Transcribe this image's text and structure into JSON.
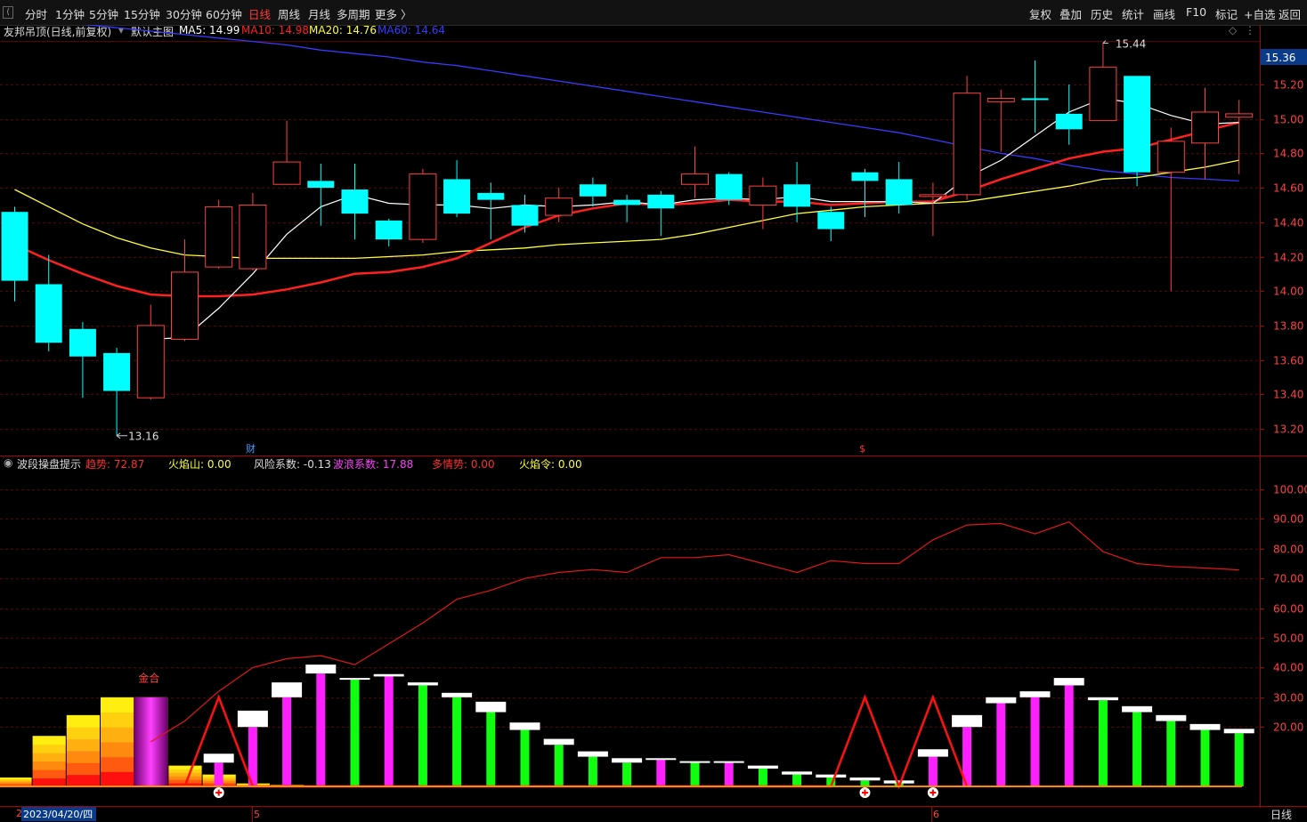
{
  "toolbar": {
    "periods": [
      "分时",
      "1分钟",
      "5分钟",
      "15分钟",
      "30分钟",
      "60分钟",
      "日线",
      "周线",
      "月线",
      "多周期",
      "更多 〉"
    ],
    "active": "日线",
    "right_buttons": [
      "复权",
      "叠加",
      "历史",
      "统计",
      "画线",
      "F10",
      "标记",
      "+自选",
      "返回"
    ]
  },
  "main_legend": {
    "title": "友邦吊顶(日线,前复权)",
    "theme": "默认主图",
    "ma": [
      {
        "label": "MA5: 14.99",
        "color": "#ffffff"
      },
      {
        "label": "MA10: 14.98",
        "color": "#ff2020"
      },
      {
        "label": "MA20: 14.76",
        "color": "#ffff40"
      },
      {
        "label": "MA60: 14.64",
        "color": "#3a3aff"
      }
    ]
  },
  "price_axis": {
    "ticks": [
      "15.20",
      "15.00",
      "14.80",
      "14.60",
      "14.40",
      "14.20",
      "14.00",
      "13.80",
      "13.60",
      "13.40",
      "13.20"
    ],
    "current": "15.36",
    "high_label": "15.44",
    "low_label": "13.16"
  },
  "event_marks": {
    "finance": "财",
    "dividend": "$"
  },
  "indicator_legend": {
    "name": "波段操盘提示",
    "items": [
      {
        "label": "趋势: 72.87",
        "color": "#ff3030"
      },
      {
        "label": "火焰山: 0.00",
        "color": "#ffff40"
      },
      {
        "label": "风险系数: -0.13",
        "color": "#dddddd"
      },
      {
        "label": "波浪系数: 17.88",
        "color": "#ff40ff"
      },
      {
        "label": "多情势: 0.00",
        "color": "#ff3030"
      },
      {
        "label": "火焰令: 0.00",
        "color": "#ffff40"
      }
    ]
  },
  "indicator_axis": {
    "ticks": [
      "100.00",
      "90.00",
      "80.00",
      "70.00",
      "60.00",
      "50.00",
      "40.00",
      "30.00",
      "20.00"
    ]
  },
  "annotations": {
    "golden_cross": "金合"
  },
  "date_axis": {
    "start_date": "2023/04/20/四",
    "month_marks": [
      "5",
      "6"
    ],
    "left_mark": "2"
  },
  "period_label": "日线",
  "colors": {
    "up": "#ff4040",
    "down": "#00ffff",
    "ma5": "#ffffff",
    "ma10": "#ff2020",
    "ma20": "#ffff40",
    "ma60": "#3a3aff",
    "grid": "#5a0000",
    "trend": "#e01818"
  },
  "chart_data": {
    "type": "candlestick",
    "candles": [
      {
        "o": 14.46,
        "c": 14.06,
        "h": 14.49,
        "l": 13.94
      },
      {
        "o": 14.04,
        "c": 13.7,
        "h": 14.21,
        "l": 13.65
      },
      {
        "o": 13.78,
        "c": 13.62,
        "h": 13.82,
        "l": 13.38
      },
      {
        "o": 13.64,
        "c": 13.42,
        "h": 13.67,
        "l": 13.16
      },
      {
        "o": 13.38,
        "c": 13.8,
        "h": 13.92,
        "l": 13.37
      },
      {
        "o": 13.72,
        "c": 14.11,
        "h": 14.3,
        "l": 13.71
      },
      {
        "o": 14.14,
        "c": 14.49,
        "h": 14.53,
        "l": 14.13
      },
      {
        "o": 14.13,
        "c": 14.5,
        "h": 14.57,
        "l": 14.12
      },
      {
        "o": 14.62,
        "c": 14.75,
        "h": 14.99,
        "l": 14.62
      },
      {
        "o": 14.64,
        "c": 14.6,
        "h": 14.74,
        "l": 14.38
      },
      {
        "o": 14.59,
        "c": 14.45,
        "h": 14.74,
        "l": 14.3
      },
      {
        "o": 14.41,
        "c": 14.3,
        "h": 14.42,
        "l": 14.26
      },
      {
        "o": 14.3,
        "c": 14.68,
        "h": 14.71,
        "l": 14.28
      },
      {
        "o": 14.65,
        "c": 14.45,
        "h": 14.76,
        "l": 14.43
      },
      {
        "o": 14.57,
        "c": 14.53,
        "h": 14.63,
        "l": 14.3
      },
      {
        "o": 14.5,
        "c": 14.38,
        "h": 14.56,
        "l": 14.34
      },
      {
        "o": 14.44,
        "c": 14.54,
        "h": 14.6,
        "l": 14.4
      },
      {
        "o": 14.62,
        "c": 14.55,
        "h": 14.66,
        "l": 14.49
      },
      {
        "o": 14.53,
        "c": 14.5,
        "h": 14.56,
        "l": 14.4
      },
      {
        "o": 14.56,
        "c": 14.48,
        "h": 14.58,
        "l": 14.32
      },
      {
        "o": 14.62,
        "c": 14.68,
        "h": 14.84,
        "l": 14.54
      },
      {
        "o": 14.68,
        "c": 14.53,
        "h": 14.69,
        "l": 14.5
      },
      {
        "o": 14.5,
        "c": 14.61,
        "h": 14.66,
        "l": 14.36
      },
      {
        "o": 14.62,
        "c": 14.49,
        "h": 14.75,
        "l": 14.4
      },
      {
        "o": 14.46,
        "c": 14.36,
        "h": 14.49,
        "l": 14.29
      },
      {
        "o": 14.69,
        "c": 14.64,
        "h": 14.71,
        "l": 14.43
      },
      {
        "o": 14.65,
        "c": 14.5,
        "h": 14.75,
        "l": 14.45
      },
      {
        "o": 14.55,
        "c": 14.56,
        "h": 14.63,
        "l": 14.32
      },
      {
        "o": 14.56,
        "c": 15.15,
        "h": 15.25,
        "l": 14.53
      },
      {
        "o": 15.1,
        "c": 15.12,
        "h": 15.17,
        "l": 14.81
      },
      {
        "o": 15.12,
        "c": 15.11,
        "h": 15.34,
        "l": 14.92
      },
      {
        "o": 15.03,
        "c": 14.94,
        "h": 15.2,
        "l": 14.85
      },
      {
        "o": 14.99,
        "c": 15.3,
        "h": 15.44,
        "l": 14.99
      },
      {
        "o": 15.25,
        "c": 14.69,
        "h": 15.25,
        "l": 14.61
      },
      {
        "o": 14.69,
        "c": 14.87,
        "h": 14.95,
        "l": 14.0
      },
      {
        "o": 14.86,
        "c": 15.04,
        "h": 15.18,
        "l": 14.65
      },
      {
        "o": 15.01,
        "c": 15.03,
        "h": 15.11,
        "l": 14.68
      }
    ],
    "ma5": [
      null,
      null,
      null,
      null,
      13.72,
      13.73,
      13.9,
      14.1,
      14.33,
      14.49,
      14.56,
      14.51,
      14.5,
      14.5,
      14.48,
      14.5,
      14.49,
      14.5,
      14.52,
      14.5,
      14.53,
      14.54,
      14.53,
      14.55,
      14.52,
      14.52,
      14.52,
      14.51,
      14.66,
      14.76,
      14.9,
      15.04,
      15.12,
      15.09,
      15.02,
      14.97,
      14.98
    ],
    "ma10": [
      14.27,
      14.18,
      14.1,
      14.03,
      13.98,
      13.97,
      13.97,
      13.98,
      14.01,
      14.05,
      14.1,
      14.11,
      14.14,
      14.19,
      14.28,
      14.37,
      14.44,
      14.48,
      14.51,
      14.5,
      14.51,
      14.53,
      14.52,
      14.52,
      14.5,
      14.51,
      14.52,
      14.52,
      14.58,
      14.65,
      14.71,
      14.77,
      14.81,
      14.83,
      14.88,
      14.93,
      14.98
    ],
    "ma20": [
      14.59,
      14.49,
      14.39,
      14.31,
      14.25,
      14.21,
      14.2,
      14.19,
      14.19,
      14.19,
      14.19,
      14.2,
      14.21,
      14.23,
      14.24,
      14.25,
      14.27,
      14.28,
      14.29,
      14.3,
      14.33,
      14.37,
      14.41,
      14.45,
      14.47,
      14.49,
      14.5,
      14.51,
      14.52,
      14.55,
      14.58,
      14.61,
      14.65,
      14.66,
      14.69,
      14.72,
      14.76
    ],
    "ma60": [
      15.59,
      15.57,
      15.55,
      15.53,
      15.51,
      15.49,
      15.47,
      15.45,
      15.43,
      15.4,
      15.38,
      15.36,
      15.33,
      15.31,
      15.28,
      15.25,
      15.22,
      15.19,
      15.16,
      15.13,
      15.1,
      15.07,
      15.04,
      15.01,
      14.98,
      14.95,
      14.92,
      14.88,
      14.84,
      14.8,
      14.77,
      14.73,
      14.7,
      14.68,
      14.66,
      14.65,
      14.64
    ],
    "trend": [
      null,
      null,
      null,
      null,
      15.0,
      22.0,
      32.0,
      40.0,
      43.0,
      44.0,
      41.0,
      48.0,
      55.0,
      63.0,
      66.0,
      70.0,
      72.0,
      73.0,
      72.0,
      77.0,
      77.0,
      78.0,
      75.0,
      72.0,
      76.0,
      75.0,
      75.0,
      83.0,
      88.0,
      88.5,
      85.0,
      89.0,
      79.0,
      75.0,
      74.0,
      73.5,
      72.87
    ],
    "wave": [
      null,
      null,
      null,
      null,
      null,
      null,
      8.0,
      20.0,
      30.0,
      38.0,
      36.0,
      37.0,
      34.0,
      30.0,
      25.0,
      19.0,
      14.0,
      10.0,
      8.0,
      9.0,
      8.0,
      8.0,
      6.0,
      4.0,
      3.0,
      2.0,
      1.0,
      10.0,
      20.0,
      28.0,
      30.0,
      34.0,
      29.0,
      25.0,
      22.0,
      19.0,
      17.88
    ],
    "wave_up": [
      null,
      null,
      null,
      null,
      null,
      null,
      true,
      true,
      true,
      true,
      false,
      true,
      false,
      false,
      false,
      false,
      false,
      false,
      false,
      true,
      false,
      true,
      false,
      false,
      false,
      false,
      false,
      true,
      true,
      true,
      true,
      true,
      false,
      false,
      false,
      false,
      false
    ],
    "wave_cap": [
      null,
      null,
      null,
      null,
      null,
      null,
      3.0,
      5.5,
      5.0,
      3.0,
      0.5,
      0.8,
      1.0,
      1.5,
      3.5,
      2.5,
      2.0,
      1.8,
      1.5,
      0.5,
      0.5,
      0.5,
      1.0,
      1.0,
      1.0,
      1.0,
      1.0,
      2.5,
      4.0,
      2.0,
      2.0,
      2.5,
      1.0,
      2.0,
      2.0,
      2.0,
      1.5
    ],
    "zigzag": [
      [
        5,
        0
      ],
      [
        6,
        30
      ],
      [
        7,
        0
      ],
      [
        24,
        0
      ],
      [
        25,
        30
      ],
      [
        26,
        0
      ],
      [
        27,
        30
      ],
      [
        28,
        0
      ]
    ],
    "buy_signals": [
      6,
      25,
      27
    ],
    "flame_bars": [
      {
        "i": 0,
        "v": 3
      },
      {
        "i": 1,
        "v": 17
      },
      {
        "i": 2,
        "v": 24
      },
      {
        "i": 3,
        "v": 30
      },
      {
        "i": 4,
        "v": 30
      },
      {
        "i": 5,
        "v": 7
      },
      {
        "i": 6,
        "v": 4
      },
      {
        "i": 7,
        "v": 1
      },
      {
        "i": 8,
        "v": 0.5
      }
    ],
    "ylim_price": [
      13.1,
      15.5
    ],
    "ylim_indicator": [
      0,
      108
    ]
  }
}
